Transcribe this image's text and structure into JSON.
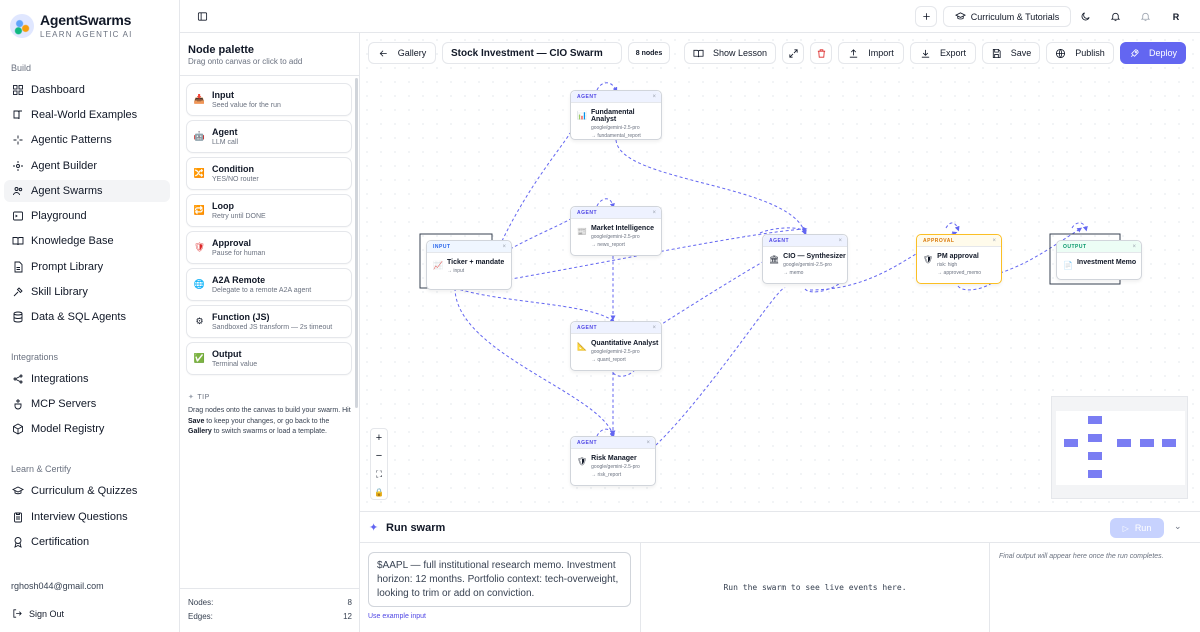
{
  "brand": {
    "name": "AgentSwarms",
    "tagline": "LEARN AGENTIC AI"
  },
  "sidebar": {
    "sections": [
      {
        "label": "Build",
        "items": [
          {
            "label": "Dashboard",
            "icon": "layout-grid-icon"
          },
          {
            "label": "Real-World Examples",
            "icon": "book-icon"
          },
          {
            "label": "Agentic Patterns",
            "icon": "sparkle-icon"
          },
          {
            "label": "Agent Builder",
            "icon": "wrench-icon"
          },
          {
            "label": "Agent Swarms",
            "icon": "users-icon",
            "active": true
          },
          {
            "label": "Playground",
            "icon": "terminal-icon"
          },
          {
            "label": "Knowledge Base",
            "icon": "book-open-icon"
          },
          {
            "label": "Prompt Library",
            "icon": "document-icon"
          },
          {
            "label": "Skill Library",
            "icon": "tools-icon"
          },
          {
            "label": "Data & SQL Agents",
            "icon": "database-icon"
          }
        ]
      },
      {
        "label": "Integrations",
        "items": [
          {
            "label": "Integrations",
            "icon": "plug-icon"
          },
          {
            "label": "MCP Servers",
            "icon": "server-icon"
          },
          {
            "label": "Model Registry",
            "icon": "cube-icon"
          }
        ]
      },
      {
        "label": "Learn & Certify",
        "items": [
          {
            "label": "Curriculum & Quizzes",
            "icon": "graduation-cap-icon"
          },
          {
            "label": "Interview Questions",
            "icon": "clipboard-icon"
          },
          {
            "label": "Certification",
            "icon": "award-icon"
          }
        ]
      }
    ],
    "user_email": "rghosh044@gmail.com",
    "sign_out": "Sign Out"
  },
  "topbar": {
    "curriculum_label": "Curriculum & Tutorials",
    "avatar_initial": "R"
  },
  "palette": {
    "title": "Node palette",
    "subtitle": "Drag onto canvas or click to add",
    "items": [
      {
        "name": "Input",
        "desc": "Seed value for the run",
        "icon": "📥"
      },
      {
        "name": "Agent",
        "desc": "LLM call",
        "icon": "🤖"
      },
      {
        "name": "Condition",
        "desc": "YES/NO router",
        "icon": "🔀"
      },
      {
        "name": "Loop",
        "desc": "Retry until DONE",
        "icon": "🔁"
      },
      {
        "name": "Approval",
        "desc": "Pause for human",
        "icon": "🛡"
      },
      {
        "name": "A2A Remote",
        "desc": "Delegate to a remote A2A agent",
        "icon": "🌐"
      },
      {
        "name": "Function (JS)",
        "desc": "Sandboxed JS transform — 2s timeout",
        "icon": "⚙"
      },
      {
        "name": "Output",
        "desc": "Terminal value",
        "icon": "✅"
      }
    ],
    "tip_label": "TIP",
    "tip_pre": "Drag nodes onto the canvas to build your swarm. Hit ",
    "tip_save": "Save",
    "tip_mid": " to keep your changes, or go back to the ",
    "tip_gallery": "Gallery",
    "tip_post": " to switch swarms or load a template.",
    "nodes_label": "Nodes:",
    "nodes_value": "8",
    "edges_label": "Edges:",
    "edges_value": "12"
  },
  "toolbar": {
    "gallery": "Gallery",
    "swarm_name": "Stock Investment — CIO Swarm",
    "node_count": "8 nodes",
    "show_lesson": "Show Lesson",
    "import": "Import",
    "export": "Export",
    "save": "Save",
    "publish": "Publish",
    "deploy": "Deploy"
  },
  "nodes": {
    "input": {
      "type": "INPUT",
      "title": "Ticker + mandate",
      "meta1": "→ input",
      "icon": "📈"
    },
    "fundamental": {
      "type": "AGENT",
      "title": "Fundamental Analyst",
      "meta1": "google/gemini-2.5-pro",
      "meta2": "→ fundamental_report",
      "icon": "📊"
    },
    "market": {
      "type": "AGENT",
      "title": "Market Intelligence",
      "meta1": "google/gemini-2.5-pro",
      "meta2": "→ news_report",
      "icon": "📰"
    },
    "quant": {
      "type": "AGENT",
      "title": "Quantitative Analyst",
      "meta1": "google/gemini-2.5-pro",
      "meta2": "→ quant_report",
      "icon": "📐"
    },
    "risk": {
      "type": "AGENT",
      "title": "Risk Manager",
      "meta1": "google/gemini-2.5-pro",
      "meta2": "→ risk_report",
      "icon": "🛡"
    },
    "cio": {
      "type": "AGENT",
      "title": "CIO — Synthesizer",
      "meta1": "google/gemini-2.5-pro",
      "meta2": "→ memo",
      "icon": "🏛"
    },
    "pm": {
      "type": "APPROVAL",
      "title": "PM approval",
      "meta1": "risk: high",
      "meta2": "→ approved_memo",
      "icon": "🛡"
    },
    "output": {
      "type": "OUTPUT",
      "title": "Investment Memo",
      "icon": "📄"
    }
  },
  "run": {
    "title": "Run swarm",
    "run_button": "Run",
    "input_text": "$AAPL — full institutional research memo. Investment horizon: 12 months. Portfolio context: tech-overweight, looking to trim or add on conviction.",
    "example_link": "Use example input",
    "events_placeholder": "Run the swarm to see live events here.",
    "final_placeholder": "Final output will appear here once the run completes."
  },
  "colors": {
    "accent": "#6366f1",
    "edge": "#6366f1"
  }
}
